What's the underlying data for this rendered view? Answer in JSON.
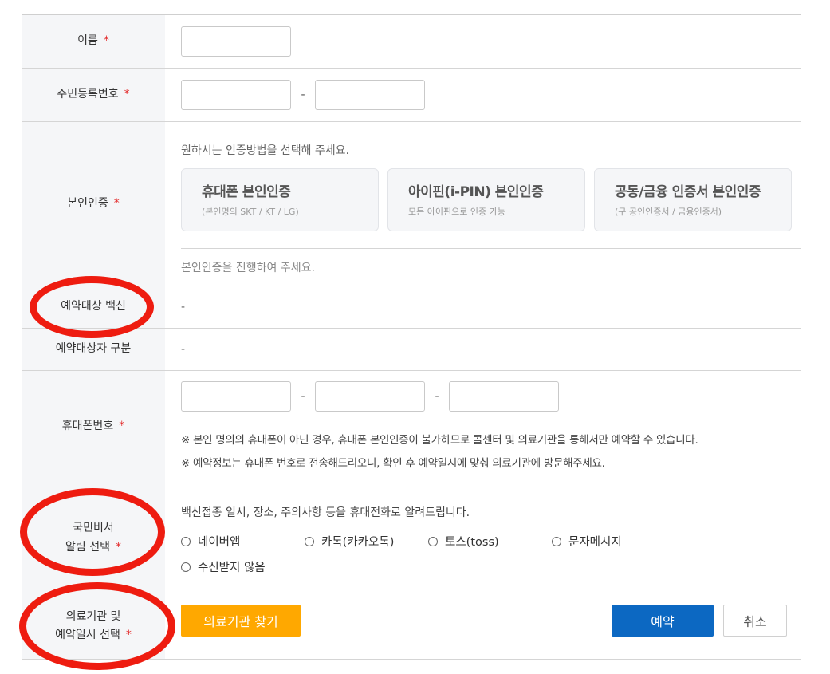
{
  "form": {
    "name": {
      "label": "이름",
      "required_mark": "*"
    },
    "rrn": {
      "label": "주민등록번호",
      "required_mark": "*",
      "separator": "-"
    },
    "auth": {
      "label": "본인인증",
      "required_mark": "*",
      "instruction": "원하시는 인증방법을 선택해 주세요.",
      "options": [
        {
          "title": "휴대폰 본인인증",
          "sub": "(본인명의 SKT / KT / LG)"
        },
        {
          "title": "아이핀(i-PIN) 본인인증",
          "sub": "모든 아이핀으로 인증 가능"
        },
        {
          "title": "공동/금융 인증서 본인인증",
          "sub": "(구 공인인증서 / 금융인증서)"
        }
      ],
      "status": "본인인증을 진행하여 주세요."
    },
    "vaccine": {
      "label": "예약대상 백신",
      "value": "-"
    },
    "target_type": {
      "label": "예약대상자 구분",
      "value": "-"
    },
    "phone": {
      "label": "휴대폰번호",
      "required_mark": "*",
      "separator": "-",
      "notes": [
        "※ 본인 명의의 휴대폰이 아닌 경우, 휴대폰 본인인증이 불가하므로 콜센터 및 의료기관을 통해서만 예약할 수 있습니다.",
        "※ 예약정보는 휴대폰 번호로 전송해드리오니, 확인 후 예약일시에 맞춰 의료기관에 방문해주세요."
      ]
    },
    "notify": {
      "label_line1": "국민비서",
      "label_line2": "알림 선택",
      "required_mark": "*",
      "description": "백신접종 일시, 장소, 주의사항 등을 휴대전화로 알려드립니다.",
      "options": [
        "네이버앱",
        "카톡(카카오톡)",
        "토스(toss)",
        "문자메시지",
        "수신받지 않음"
      ]
    },
    "clinic": {
      "label_line1": "의료기관 및",
      "label_line2": "예약일시 선택",
      "required_mark": "*",
      "find_button": "의료기관 찾기"
    }
  },
  "actions": {
    "reserve": "예약",
    "cancel": "취소"
  },
  "colors": {
    "required": "#e32b2b",
    "find_button": "#ffa800",
    "reserve_button": "#0c68c2",
    "annotation": "#ee1c10"
  }
}
